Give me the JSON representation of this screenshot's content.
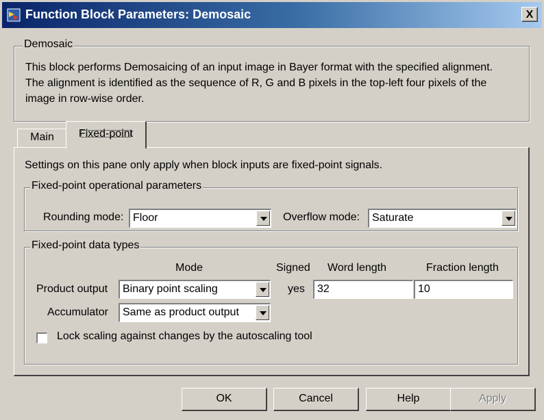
{
  "window": {
    "title": "Function Block Parameters: Demosaic",
    "close_label": "X"
  },
  "block": {
    "group_label": "Demosaic",
    "description": "This block performs Demosaicing of an input image in Bayer format with the specified alignment.\nThe alignment is identified as the sequence of R, G and B pixels in the top-left four pixels of the\nimage in row-wise order."
  },
  "tabs": [
    {
      "label": "Main",
      "selected": false
    },
    {
      "label": "Fixed-point",
      "selected": true
    }
  ],
  "fixed_point": {
    "settings_note": "Settings on this pane only apply when block inputs are fixed-point signals.",
    "operational": {
      "group_label": "Fixed-point operational parameters",
      "rounding_label": "Rounding mode:",
      "rounding_value": "Floor",
      "overflow_label": "Overflow mode:",
      "overflow_value": "Saturate"
    },
    "data_types": {
      "group_label": "Fixed-point data types",
      "headers": {
        "mode": "Mode",
        "signed": "Signed",
        "word_length": "Word length",
        "fraction_length": "Fraction length"
      },
      "rows": [
        {
          "label": "Product output",
          "mode": "Binary point scaling",
          "signed": "yes",
          "word_length": "32",
          "fraction_length": "10"
        },
        {
          "label": "Accumulator",
          "mode": "Same as product output"
        }
      ],
      "lock_label": "Lock scaling against changes by the autoscaling tool",
      "lock_checked": false
    }
  },
  "buttons": {
    "ok": "OK",
    "cancel": "Cancel",
    "help": "Help",
    "apply": "Apply"
  },
  "colors": {
    "title_bar_start": "#0a246a",
    "title_bar_end": "#a6caf0",
    "dialog_bg": "#d4d0c8"
  }
}
